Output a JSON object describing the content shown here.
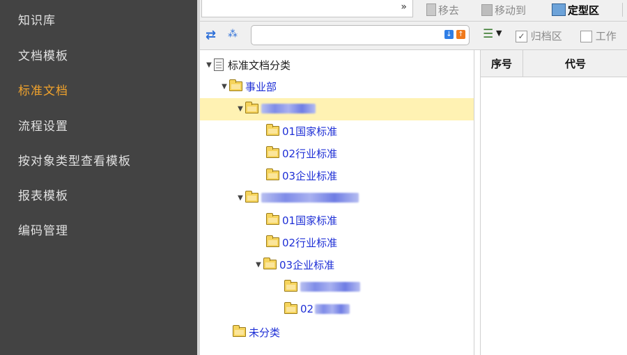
{
  "sidebar": {
    "items": [
      {
        "label": "知识库",
        "active": false
      },
      {
        "label": "文档模板",
        "active": false
      },
      {
        "label": "标准文档",
        "active": true
      },
      {
        "label": "流程设置",
        "active": false
      },
      {
        "label": "按对象类型查看模板",
        "active": false
      },
      {
        "label": "报表模板",
        "active": false
      },
      {
        "label": "编码管理",
        "active": false
      }
    ]
  },
  "toolbar": {
    "combo_value": "",
    "move_out_label": "移去",
    "move_to_label": "移动到",
    "finalize_label": "定型区"
  },
  "toolbar2": {
    "search_value": "",
    "archive_label": "归档区",
    "work_label": "工作"
  },
  "tree": {
    "root": "标准文档分类",
    "division": "事业部",
    "group1_label": "",
    "group1_children": [
      "01国家标准",
      "02行业标准",
      "03企业标准"
    ],
    "group2_label": "",
    "group2_children": [
      "01国家标准",
      "02行业标准",
      "03企业标准"
    ],
    "group2_sub": [
      "",
      "02"
    ],
    "unclassified": "未分类"
  },
  "grid": {
    "columns": [
      "序号",
      "代号"
    ]
  },
  "colors": {
    "sidebar_bg": "#434343",
    "sidebar_active": "#f0a22c",
    "tree_link": "#1e2fd6",
    "selection": "#fff2b3"
  }
}
